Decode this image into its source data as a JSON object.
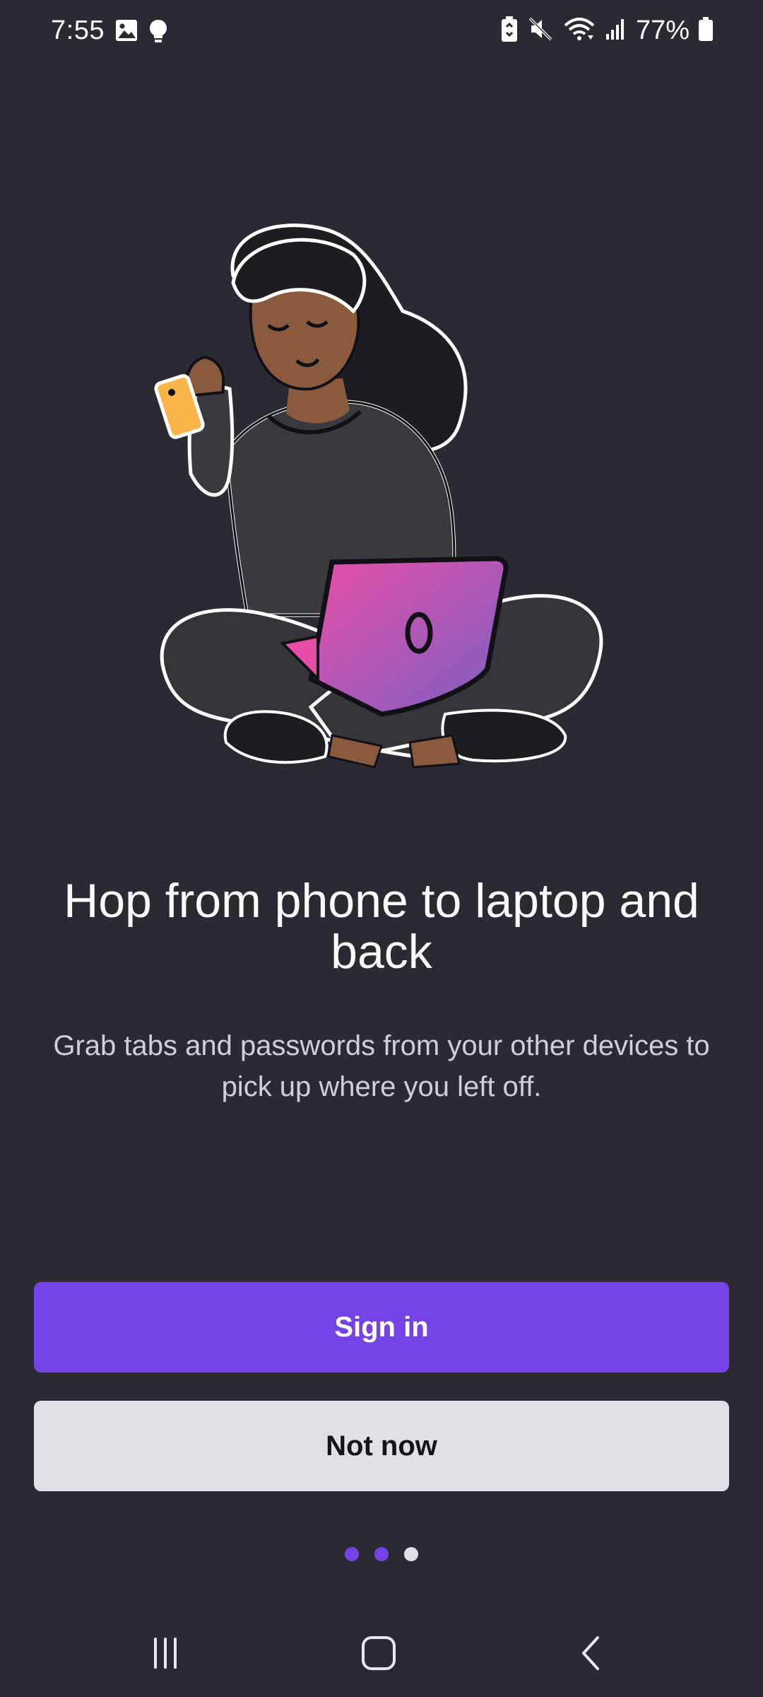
{
  "status_bar": {
    "time": "7:55",
    "battery_percent": "77%",
    "left_icons": [
      "gallery-icon",
      "lightbulb-icon"
    ],
    "right_icons": [
      "battery-saver-icon",
      "mute-icon",
      "wifi-icon",
      "signal-icon",
      "battery-icon"
    ]
  },
  "onboarding": {
    "title": "Hop from phone to laptop and back",
    "description": "Grab tabs and passwords from your other devices to pick up where you left off.",
    "illustration": "person-with-phone-and-laptop-illustration"
  },
  "buttons": {
    "sign_in": "Sign in",
    "not_now": "Not now"
  },
  "page_indicator": {
    "total": 3,
    "current": 2,
    "active_color": "#7542e5",
    "inactive_color": "#e1e0e6"
  },
  "colors": {
    "background": "#2b2a33",
    "primary": "#7542e5",
    "secondary_button": "#e1e0e6",
    "title_text": "#fbfbfe",
    "body_text": "#cfcfd8"
  },
  "navigation_bar": {
    "buttons": [
      "recent-apps-icon",
      "home-icon",
      "back-icon"
    ]
  }
}
